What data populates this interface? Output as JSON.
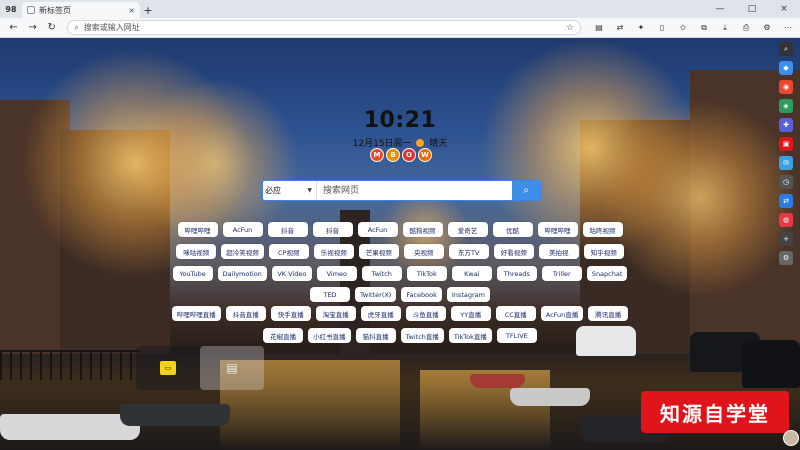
{
  "browser": {
    "logo": "98",
    "tab_title": "新标签页",
    "tab_close": "×",
    "new_tab": "+",
    "address_placeholder": "搜索或输入网址",
    "window": {
      "minimize": "—",
      "maximize": "□",
      "close": "×"
    }
  },
  "clock": {
    "time": "10:21",
    "date": "12月15日周一",
    "weather": "晴天"
  },
  "badges": [
    {
      "letter": "M",
      "color": "#e84a2f"
    },
    {
      "letter": "B",
      "color": "#f08a00"
    },
    {
      "letter": "O",
      "color": "#e8302f"
    },
    {
      "letter": "W",
      "color": "#f06a00"
    }
  ],
  "search": {
    "engine": "必应",
    "placeholder": "搜索网页"
  },
  "quick_links": [
    [
      "哔哩哔哩",
      "AcFun",
      "抖音",
      "抖音",
      "AcFun",
      "酷狗视频",
      "爱奇艺",
      "优酷",
      "哔哩哔哩",
      "咕咚视频"
    ],
    [
      "咪咕视频",
      "超冷笑视频",
      "CP视频",
      "乐视视频",
      "芒果视频",
      "央视频",
      "东方TV",
      "好看视频",
      "美拍视",
      "知乎视频"
    ],
    [
      "YouTube",
      "Dailymotion",
      "VK Video",
      "Vimeo",
      "Twitch",
      "TikTok",
      "Kwai",
      "Threads",
      "Triller",
      "Snapchat"
    ],
    [
      "TED",
      "Twitter(X)",
      "Facebook",
      "Instagram"
    ],
    [
      "哔哩哔哩直播",
      "抖音直播",
      "快手直播",
      "淘宝直播",
      "虎牙直播",
      "斗鱼直播",
      "YY直播",
      "CC直播",
      "AcFun直播",
      "腾讯直播"
    ],
    [
      "花椒直播",
      "小红书直播",
      "猫抖直播",
      "Twitch直播",
      "TikTok直播",
      "TFLIVE"
    ]
  ],
  "watermark": "知源自学堂"
}
